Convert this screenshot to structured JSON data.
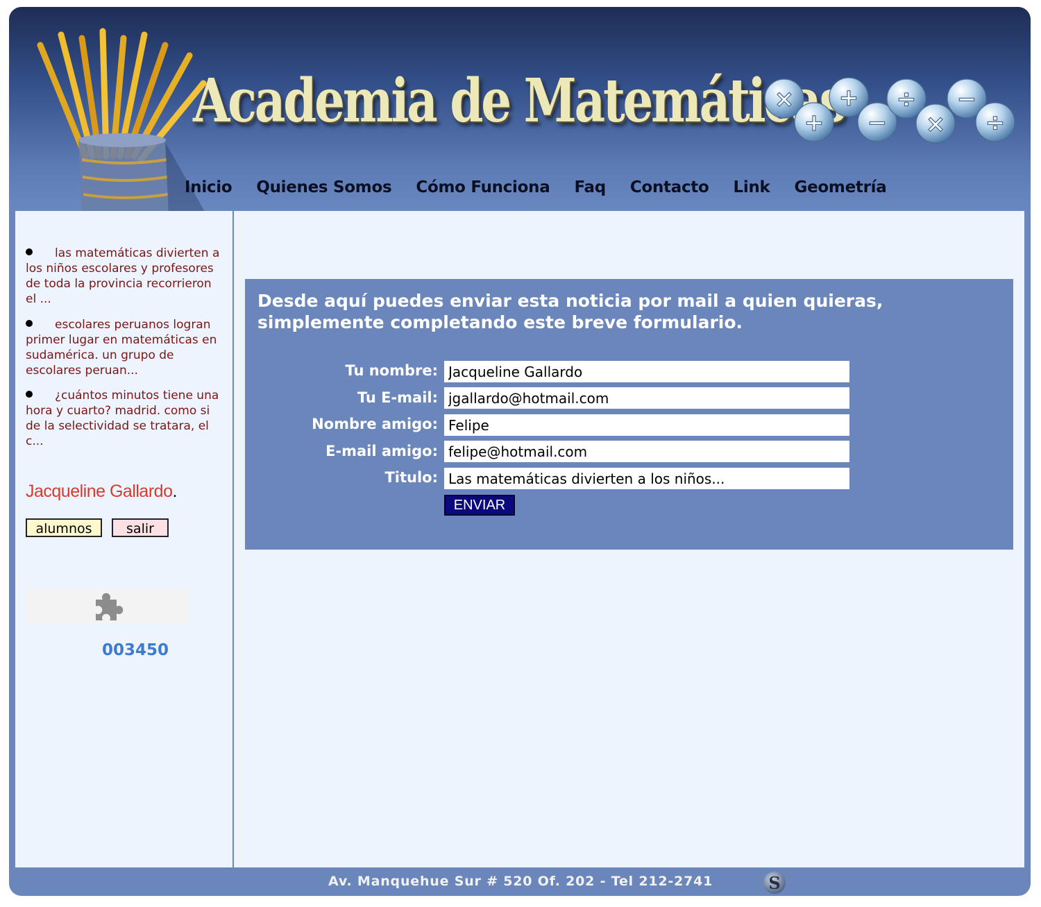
{
  "header": {
    "site_title": "Academia de Matemáticas",
    "nav": [
      "Inicio",
      "Quienes Somos",
      "Cómo Funciona",
      "Faq",
      "Contacto",
      "Link",
      "Geometría"
    ]
  },
  "sidebar": {
    "news": [
      "las matemáticas divierten a los niños escolares y profesores de toda la provincia recorrieron el ...",
      "escolares peruanos logran primer lugar en matemáticas en sudamérica. un grupo de escolares peruan...",
      "¿cuántos minutos tiene una hora y cuarto? madrid. como si de la selectividad se tratara, el c..."
    ],
    "user_name": "Jacqueline Gallardo",
    "user_suffix": ".",
    "btn_alumnos": "alumnos",
    "btn_salir": "salir",
    "plugin_icon": "puzzle-icon",
    "counter": "003450"
  },
  "form": {
    "intro": "Desde aquí puedes enviar esta noticia por mail a quien quieras, simplemente completando este breve formulario.",
    "fields": [
      {
        "label": "Tu nombre:",
        "value": "Jacqueline Gallardo"
      },
      {
        "label": "Tu E-mail:",
        "value": "jgallardo@hotmail.com"
      },
      {
        "label": "Nombre amigo:",
        "value": "Felipe"
      },
      {
        "label": "E-mail amigo:",
        "value": "felipe@hotmail.com"
      },
      {
        "label": "Titulo:",
        "value": "Las matemáticas divierten a los niños..."
      }
    ],
    "submit": "ENVIAR"
  },
  "footer": {
    "address": "Av. Manquehue Sur # 520 Of. 202 - Tel 212-2741",
    "logo_icon": "s-logo-icon"
  },
  "colors": {
    "frame": "#6a86ba",
    "content_bg": "#eef4fd",
    "news_text": "#7a1616",
    "user_name": "#d93a2e",
    "counter": "#3d7ad0",
    "submit_bg": "#0a0a7e"
  }
}
